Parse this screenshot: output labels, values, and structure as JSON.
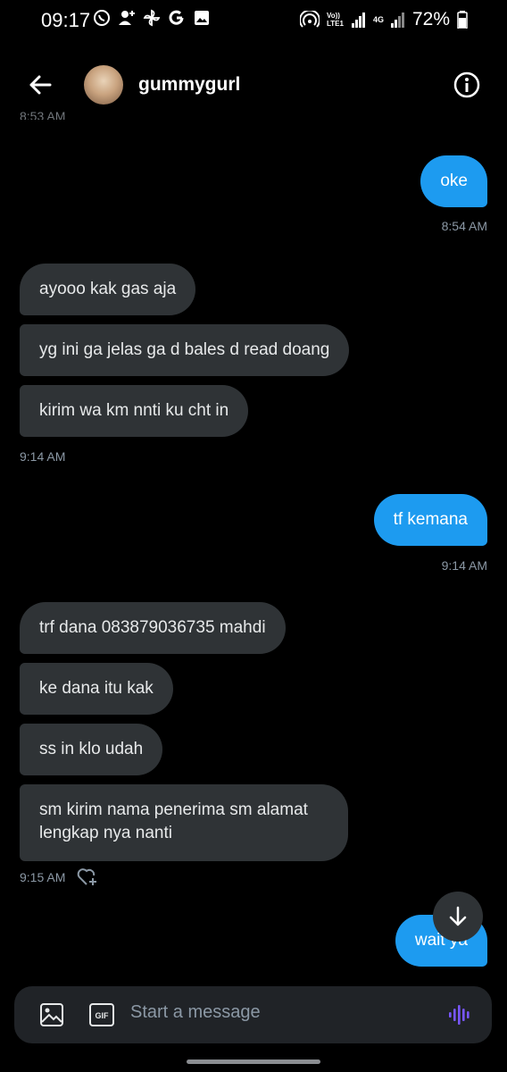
{
  "status_bar": {
    "time": "09:17",
    "network_lte": "Vo)) LTE1",
    "network_4g": "4G",
    "battery": "72%"
  },
  "header": {
    "username": "gummygurl"
  },
  "messages": [
    {
      "dir": "out",
      "text": "oke"
    },
    {
      "dir": "in",
      "text": "ayooo kak gas aja"
    },
    {
      "dir": "in",
      "text": "yg ini ga jelas ga d bales d read doang"
    },
    {
      "dir": "in",
      "text": "kirim wa km nnti ku cht in"
    },
    {
      "dir": "out",
      "text": "tf kemana"
    },
    {
      "dir": "in",
      "text": "trf dana 083879036735 mahdi"
    },
    {
      "dir": "in",
      "text": "ke dana itu kak"
    },
    {
      "dir": "in",
      "text": "ss in klo udah"
    },
    {
      "dir": "in",
      "text": "sm kirim nama penerima sm alamat lengkap nya nanti"
    },
    {
      "dir": "out",
      "text": "wait ya"
    }
  ],
  "timestamps": {
    "clipped": "8:53 AM",
    "t1": "8:54 AM",
    "t2": "9:14 AM",
    "t3": "9:14 AM",
    "t4": "9:15 AM"
  },
  "composer": {
    "placeholder": "Start a message",
    "gif_label": "GIF"
  },
  "colors": {
    "background": "#000000",
    "incoming_bubble": "#2f3336",
    "outgoing_bubble": "#1d9bf0",
    "voice_accent": "#7856ff"
  }
}
